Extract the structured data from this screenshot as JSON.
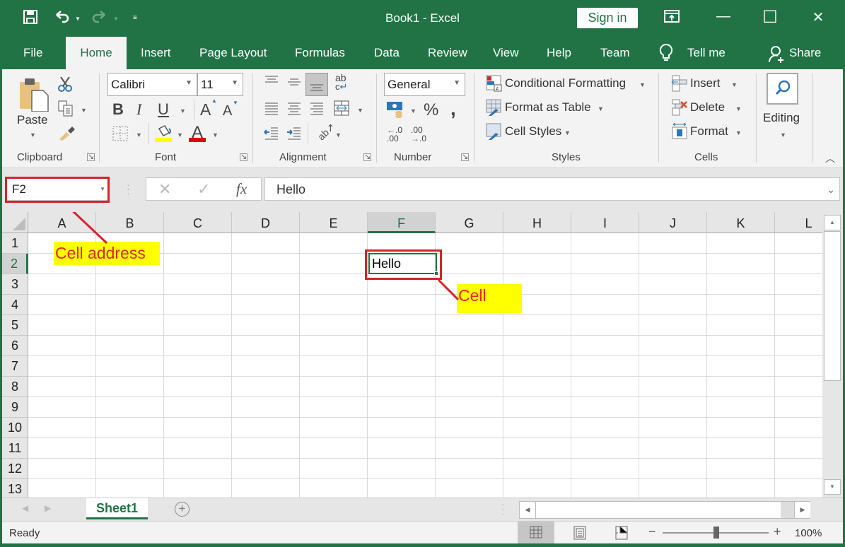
{
  "window": {
    "title": "Book1  -  Excel",
    "sign_in": "Sign in",
    "quick_access": {
      "save": "save-icon",
      "undo": "undo-icon",
      "redo": "redo-icon",
      "customize": "customize-icon"
    },
    "controls": {
      "ribbon_display": "ribbon-display-icon",
      "minimize": "—",
      "maximize": "☐",
      "close": "✕"
    }
  },
  "tabs": [
    {
      "label": "File"
    },
    {
      "label": "Home",
      "active": true
    },
    {
      "label": "Insert"
    },
    {
      "label": "Page Layout"
    },
    {
      "label": "Formulas"
    },
    {
      "label": "Data"
    },
    {
      "label": "Review"
    },
    {
      "label": "View"
    },
    {
      "label": "Help"
    },
    {
      "label": "Team"
    }
  ],
  "tell_me": "Tell me",
  "share": "Share",
  "ribbon": {
    "clipboard": {
      "label": "Clipboard",
      "paste": "Paste"
    },
    "font": {
      "label": "Font",
      "name": "Calibri",
      "size": "11",
      "bold": "B",
      "italic": "I",
      "underline": "U",
      "grow": "A",
      "shrink": "A",
      "font_color": "A",
      "highlight_color": "#ffff00",
      "text_color": "#e00000"
    },
    "alignment": {
      "label": "Alignment",
      "wrap": "ab"
    },
    "number": {
      "label": "Number",
      "format": "General",
      "percent": "%",
      "comma": ",",
      "inc_dec": "←.0 .00",
      "dec_dec": ".00 →.0"
    },
    "styles": {
      "label": "Styles",
      "conditional": "Conditional Formatting",
      "format_table": "Format as Table",
      "cell_styles": "Cell Styles"
    },
    "cells": {
      "label": "Cells",
      "insert": "Insert",
      "delete": "Delete",
      "format": "Format"
    },
    "editing": {
      "label": "Editing"
    }
  },
  "formula_bar": {
    "name_box": "F2",
    "cancel": "✕",
    "enter": "✓",
    "fx": "fx",
    "value": "Hello"
  },
  "grid": {
    "columns": [
      "A",
      "B",
      "C",
      "D",
      "E",
      "F",
      "G",
      "H",
      "I",
      "J",
      "K",
      "L"
    ],
    "rows": [
      "1",
      "2",
      "3",
      "4",
      "5",
      "6",
      "7",
      "8",
      "9",
      "10",
      "11",
      "12",
      "13"
    ],
    "selected_column": "F",
    "selected_row": "2",
    "cells": [
      {
        "ref": "F2",
        "value": "Hello"
      }
    ]
  },
  "annotations": {
    "cell_address": "Cell address",
    "cell": "Cell",
    "color": "#e0261f"
  },
  "sheets": [
    {
      "label": "Sheet1",
      "active": true
    }
  ],
  "status": {
    "ready": "Ready",
    "zoom": "100%",
    "zoom_minus": "−",
    "zoom_plus": "+"
  },
  "colors": {
    "accent": "#217346",
    "annotation_border": "#d5232b",
    "callout_bg": "#ffff00"
  }
}
